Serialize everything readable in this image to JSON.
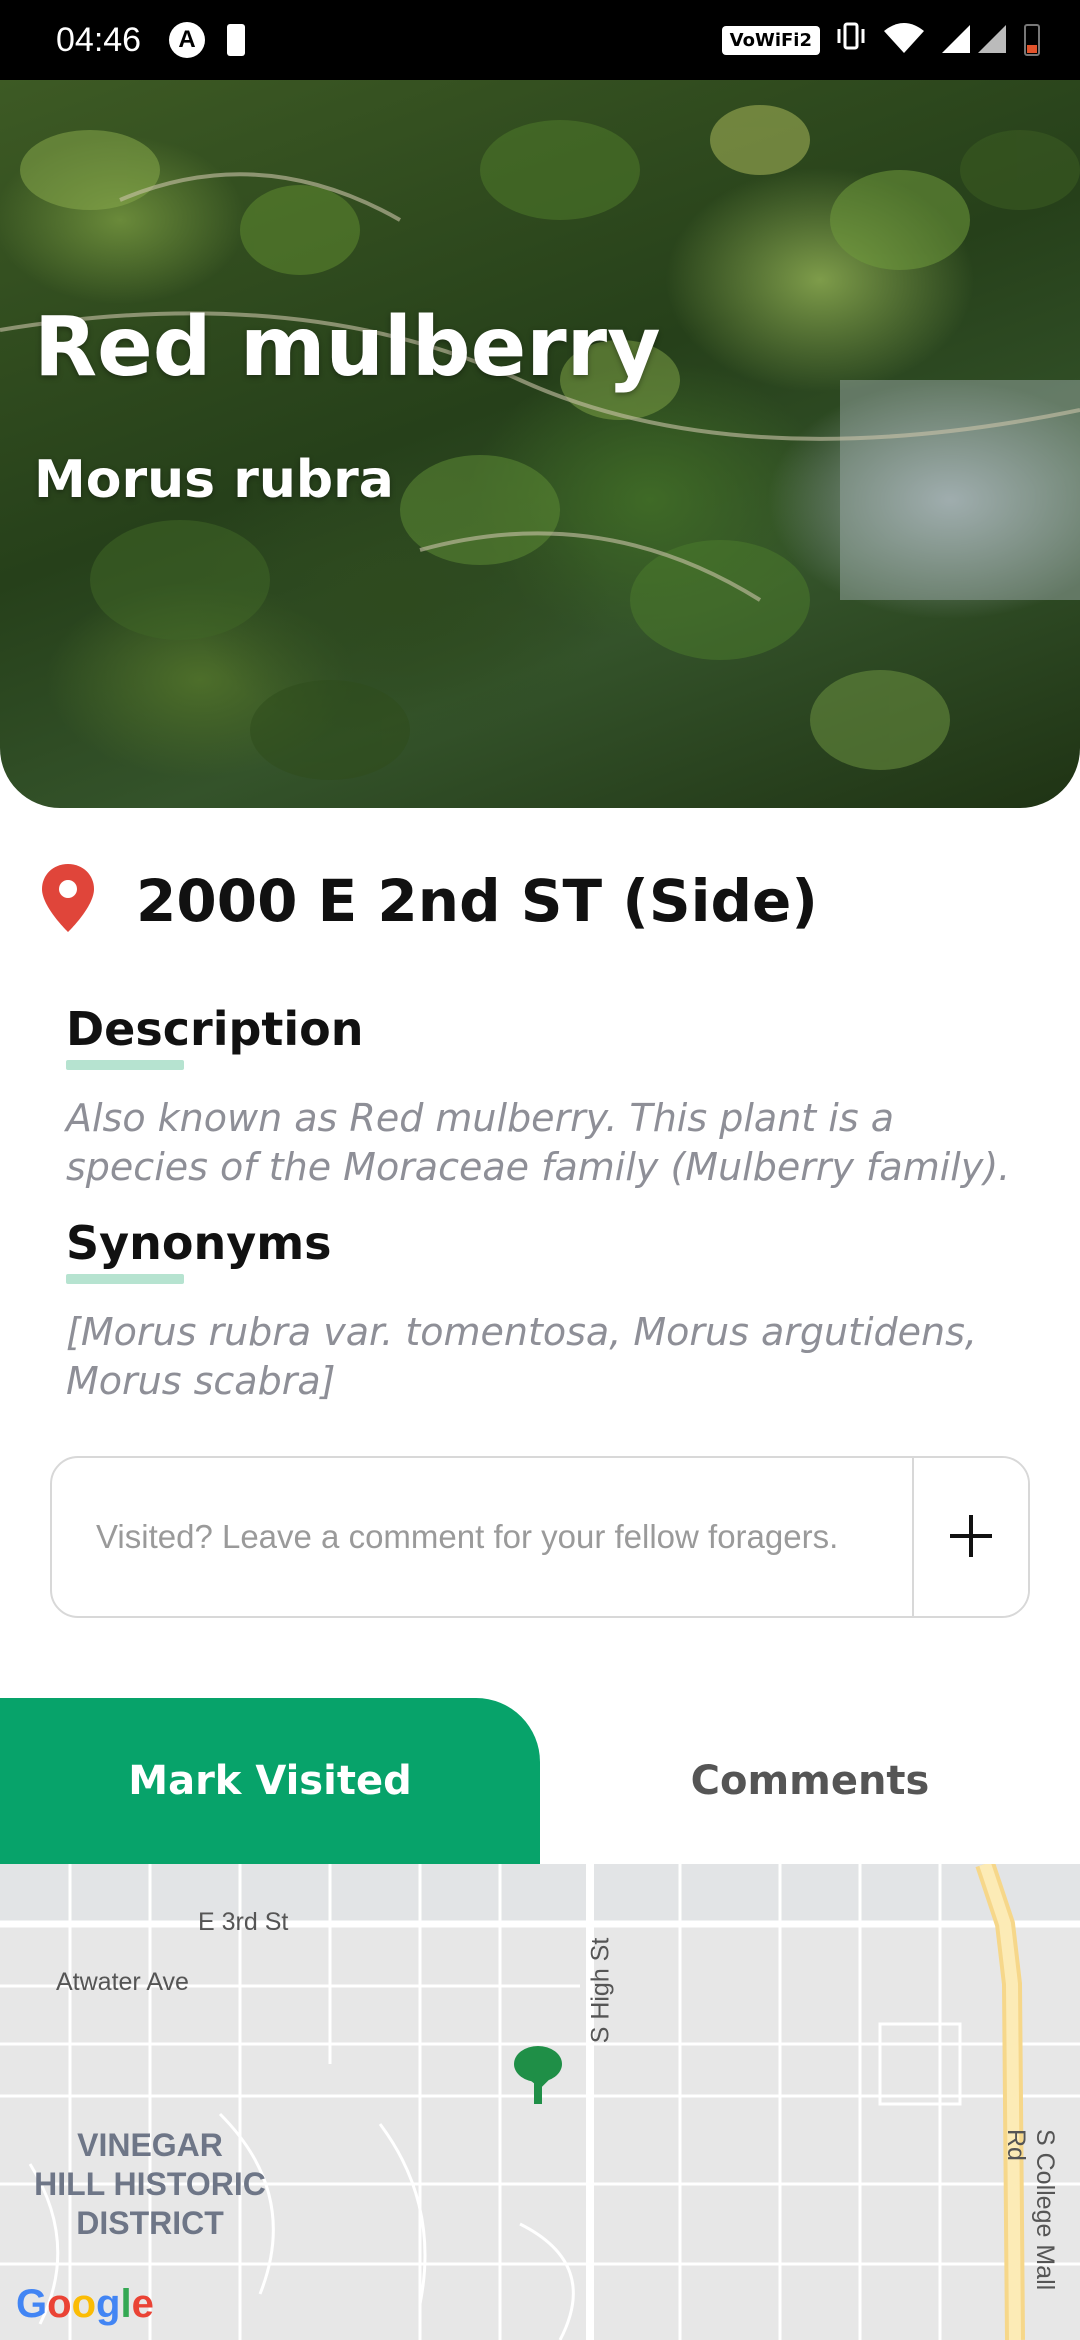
{
  "status_bar": {
    "time": "04:46",
    "wifi_badge": "VoWiFi2",
    "notification_icons": [
      "a-icon",
      "battery-saver-icon"
    ],
    "right_icons": [
      "vibrate-icon",
      "wifi-icon",
      "signal-icon",
      "battery-icon"
    ]
  },
  "plant": {
    "common_name": "Red mulberry",
    "scientific_name": "Morus rubra"
  },
  "location": {
    "address": "2000 E 2nd ST (Side)",
    "icon": "map-pin-icon",
    "pin_color": "#e0453a"
  },
  "description": {
    "heading": "Description",
    "text": "Also known as Red mulberry. This plant is a species of the Moraceae family (Mulberry family)."
  },
  "synonyms": {
    "heading": "Synonyms",
    "text": "[Morus rubra var. tomentosa, Morus argutidens, Morus scabra]"
  },
  "comment": {
    "placeholder": "Visited? Leave a comment for your fellow foragers.",
    "value": "",
    "add_icon": "plus-icon"
  },
  "tabs": {
    "mark_visited": "Mark Visited",
    "comments": "Comments",
    "accent_color": "#07a36a"
  },
  "map": {
    "streets": [
      "E 3rd St",
      "Atwater Ave",
      "S High St",
      "S College Mall Rd"
    ],
    "district": "VINEGAR\nHILL HISTORIC\nDISTRICT",
    "marker_icon": "tree-icon",
    "attribution": "Google"
  }
}
